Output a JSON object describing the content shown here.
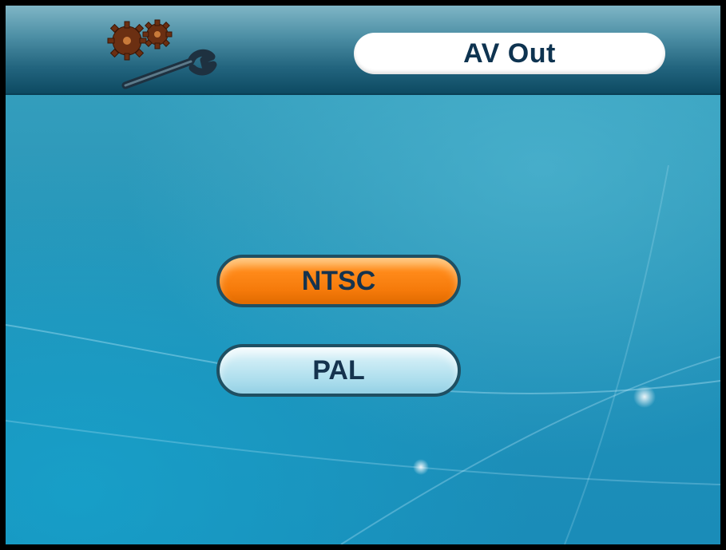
{
  "header": {
    "title": "AV Out",
    "icon": "gears-wrench-icon"
  },
  "options": [
    {
      "label": "NTSC",
      "selected": true
    },
    {
      "label": "PAL",
      "selected": false
    }
  ],
  "colors": {
    "selected_button": "#ff8a1a",
    "normal_button": "#c8eaf4",
    "title_text": "#0e3350",
    "background": "#1e8fb8"
  }
}
